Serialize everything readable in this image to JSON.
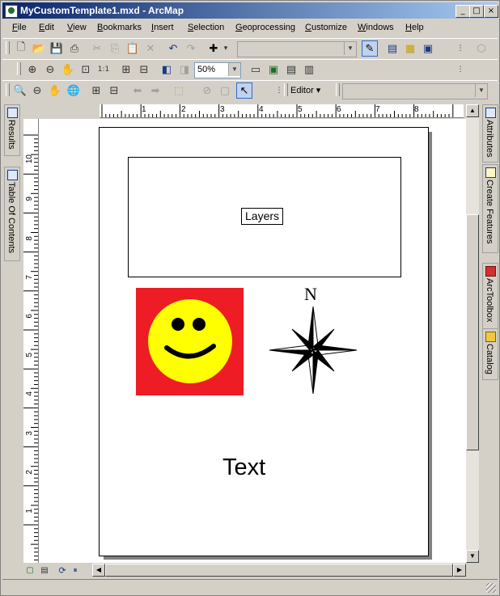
{
  "window": {
    "title": "MyCustomTemplate1.mxd - ArcMap",
    "min": "_",
    "max": "□",
    "close": "×"
  },
  "menus": [
    "File",
    "Edit",
    "View",
    "Bookmarks",
    "Insert",
    "Selection",
    "Geoprocessing",
    "Customize",
    "Windows",
    "Help"
  ],
  "toolbar": {
    "zoom_percent": "50%",
    "editor_label": "Editor ▾"
  },
  "right_tabs": [
    "Attributes",
    "Create Features",
    "ArcToolbox",
    "Catalog"
  ],
  "left_tabs": [
    "Results",
    "Table Of Contents"
  ],
  "ruler_h_numbers": [
    "1",
    "2",
    "3",
    "4",
    "5",
    "6",
    "7",
    "8"
  ],
  "ruler_v_numbers": [
    "10",
    "9",
    "8",
    "7",
    "6",
    "5",
    "4",
    "3",
    "2",
    "1"
  ],
  "layout": {
    "data_frame_label": "Layers",
    "north_label": "N",
    "text_element": "Text"
  },
  "colors": {
    "smiley_bg": "#ee1c24",
    "smiley_face": "#ffff00",
    "title_blue": "#0a246a"
  }
}
